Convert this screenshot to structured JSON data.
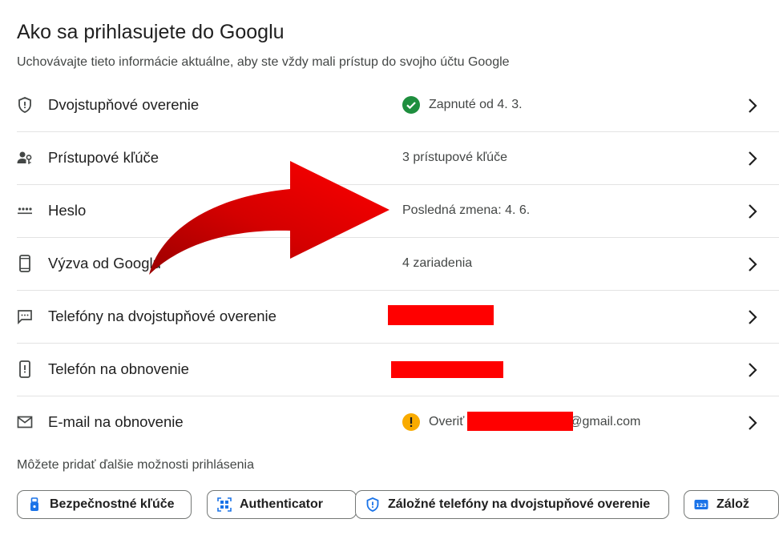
{
  "header": {
    "title": "Ako sa prihlasujete do Googlu",
    "subtitle": "Uchovávajte tieto informácie aktuálne, aby ste vždy mali prístup do svojho účtu Google"
  },
  "rows": [
    {
      "label": "Dvojstupňové overenie",
      "value": "Zapnuté od 4. 3.",
      "icon": "shield-icon",
      "status_icon": "check-circle-icon"
    },
    {
      "label": "Prístupové kľúče",
      "value": "3 prístupové kľúče",
      "icon": "passkey-icon"
    },
    {
      "label": "Heslo",
      "value": "Posledná zmena: 4. 6.",
      "icon": "password-dots-icon"
    },
    {
      "label": "Výzva od Googlu",
      "value": "4 zariadenia",
      "icon": "phone-icon"
    },
    {
      "label": "Telefóny na dvojstupňové overenie",
      "value": "",
      "icon": "message-icon"
    },
    {
      "label": "Telefón na obnovenie",
      "value": "",
      "icon": "phone-alert-icon"
    },
    {
      "label": "E-mail na obnovenie",
      "value_prefix": "Overiť",
      "value_suffix": "@gmail.com",
      "icon": "mail-icon",
      "status_icon": "warning-circle-icon"
    }
  ],
  "more_options": {
    "label": "Môžete pridať ďalšie možnosti prihlásenia",
    "chips": [
      {
        "label": "Bezpečnostné kľúče",
        "icon": "security-key-icon"
      },
      {
        "label": "Authenticator",
        "icon": "authenticator-icon"
      },
      {
        "label": "Záložné telefóny na dvojstupňové overenie",
        "icon": "shield-icon"
      },
      {
        "label": "Zálož",
        "icon": "backup-codes-icon"
      }
    ]
  },
  "colors": {
    "accent_blue": "#1a73e8",
    "success_green": "#1e8e3e",
    "warning_yellow": "#f9ab00",
    "redaction": "#ff0000",
    "annotation_arrow": "#e00000"
  }
}
